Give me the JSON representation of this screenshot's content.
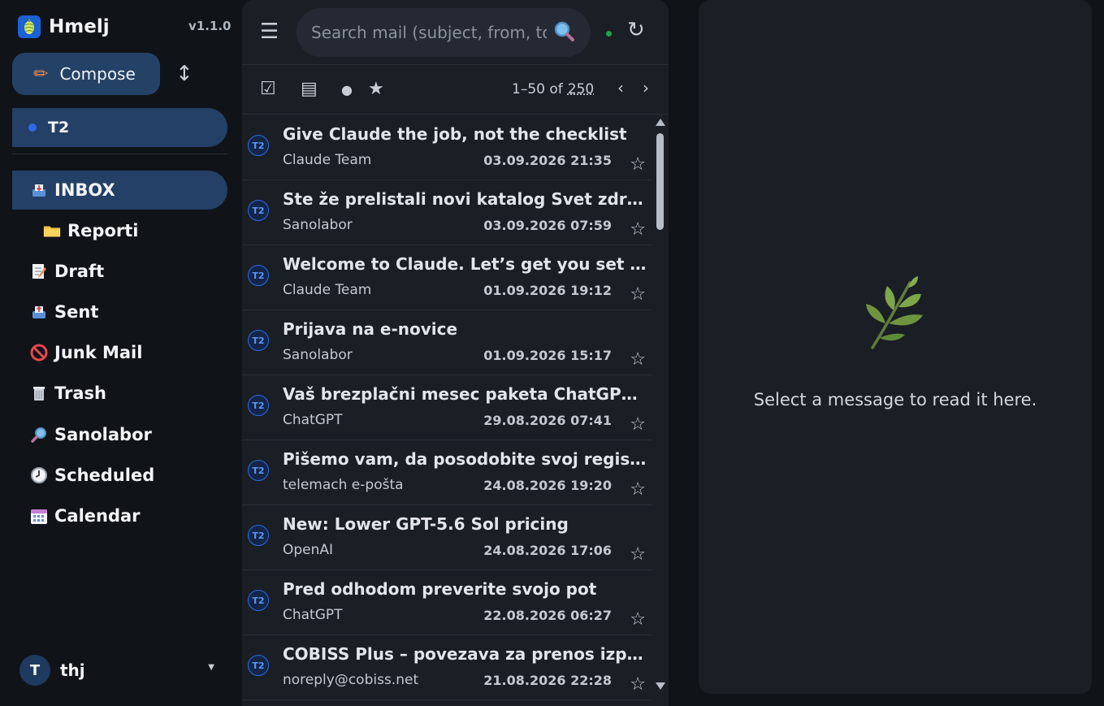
{
  "app": {
    "name": "Hmelj",
    "version": "v1.1.0"
  },
  "sidebar": {
    "compose_label": "Compose",
    "account_label": "T2",
    "folders": [
      {
        "label": "INBOX",
        "icon": "inbox-tray-icon",
        "active": true
      },
      {
        "label": "Reporti",
        "icon": "folder-icon",
        "child": true
      },
      {
        "label": "Draft",
        "icon": "memo-icon"
      },
      {
        "label": "Sent",
        "icon": "outbox-tray-icon"
      },
      {
        "label": "Junk Mail",
        "icon": "prohibited-icon"
      },
      {
        "label": "Trash",
        "icon": "wastebasket-icon"
      },
      {
        "label": "Sanolabor",
        "icon": "magnifier-icon"
      },
      {
        "label": "Scheduled",
        "icon": "clock-icon"
      },
      {
        "label": "Calendar",
        "icon": "calendar-icon"
      }
    ],
    "user": {
      "initial": "T",
      "name": "thj"
    }
  },
  "search": {
    "placeholder": "Search mail (subject, from, to…)",
    "value": ""
  },
  "pager": {
    "range": "1–50 of",
    "total": "250"
  },
  "messages": [
    {
      "badge": "T2",
      "subject": "Give Claude the job, not the checklist",
      "from": "Claude Team",
      "date": "03.09.2026 21:35"
    },
    {
      "badge": "T2",
      "subject": "Ste že prelistali novi katalog Svet zdravja?",
      "from": "Sanolabor",
      "date": "03.09.2026 07:59"
    },
    {
      "badge": "T2",
      "subject": "Welcome to Claude. Let’s get you set up.",
      "from": "Claude Team",
      "date": "01.09.2026 19:12"
    },
    {
      "badge": "T2",
      "subject": "Prijava na e-novice",
      "from": "Sanolabor",
      "date": "01.09.2026 15:17"
    },
    {
      "badge": "T2",
      "subject": "Vaš brezplačni mesec paketa ChatGPT Plus",
      "from": "ChatGPT",
      "date": "29.08.2026 07:41"
    },
    {
      "badge": "T2",
      "subject": "Pišemo vam, da posodobite svoj registrirani…",
      "from": "telemach e-pošta",
      "date": "24.08.2026 19:20"
    },
    {
      "badge": "T2",
      "subject": "New: Lower GPT-5.6 Sol pricing",
      "from": "OpenAI",
      "date": "24.08.2026 17:06"
    },
    {
      "badge": "T2",
      "subject": "Pred odhodom preverite svojo pot",
      "from": "ChatGPT",
      "date": "22.08.2026 06:27"
    },
    {
      "badge": "T2",
      "subject": "COBISS Plus – povezava za prenos izposojen…",
      "from": "noreply@cobiss.net",
      "date": "21.08.2026 22:28"
    }
  ],
  "reading_pane": {
    "empty_text": "Select a message to read it here."
  },
  "colors": {
    "accent": "#2a6ce6",
    "active_bg": "#244066",
    "status_online": "#22a447"
  }
}
